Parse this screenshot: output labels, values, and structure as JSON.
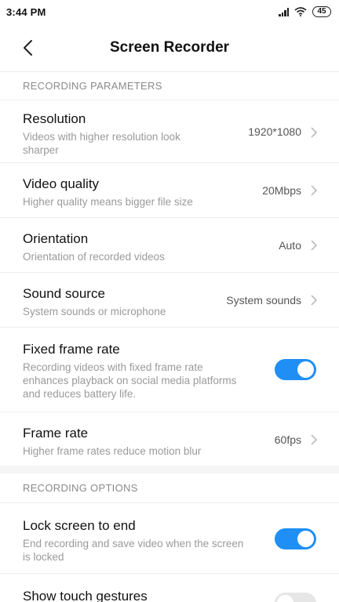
{
  "status_bar": {
    "time": "3:44 PM",
    "battery": "45"
  },
  "header": {
    "title": "Screen Recorder"
  },
  "sections": {
    "parameters": {
      "label": "RECORDING PARAMETERS"
    },
    "options": {
      "label": "RECORDING OPTIONS"
    }
  },
  "settings": {
    "resolution": {
      "title": "Resolution",
      "subtitle_line1": "Videos with higher resolution look",
      "subtitle_line2": "sharper",
      "value": "1920*1080"
    },
    "video_quality": {
      "title": "Video quality",
      "subtitle": "Higher quality means bigger file size",
      "value": "20Mbps"
    },
    "orientation": {
      "title": "Orientation",
      "subtitle": "Orientation of recorded videos",
      "value": "Auto"
    },
    "sound_source": {
      "title": "Sound source",
      "subtitle": "System sounds or microphone",
      "value": "System sounds"
    },
    "fixed_frame_rate": {
      "title": "Fixed frame rate",
      "subtitle_line1": "Recording videos with fixed frame rate",
      "subtitle_line2": "enhances playback on social media platforms",
      "subtitle_line3": "and reduces battery life.",
      "enabled": true
    },
    "frame_rate": {
      "title": "Frame rate",
      "subtitle": "Higher frame rates reduce motion blur",
      "value": "60fps"
    },
    "lock_screen": {
      "title": "Lock screen to end",
      "subtitle_line1": "End recording and save video when the screen",
      "subtitle_line2": "is locked",
      "enabled": true
    },
    "show_touch": {
      "title": "Show touch gestures",
      "enabled": false
    }
  },
  "colors": {
    "accent": "#1f8ff5",
    "toggle_off": "#e6e6e6",
    "subtitle": "#9a9a9a",
    "section_label": "#8a8a8a"
  },
  "icons": {
    "back": "chevron-left-icon",
    "row_arrow": "chevron-right-icon"
  }
}
